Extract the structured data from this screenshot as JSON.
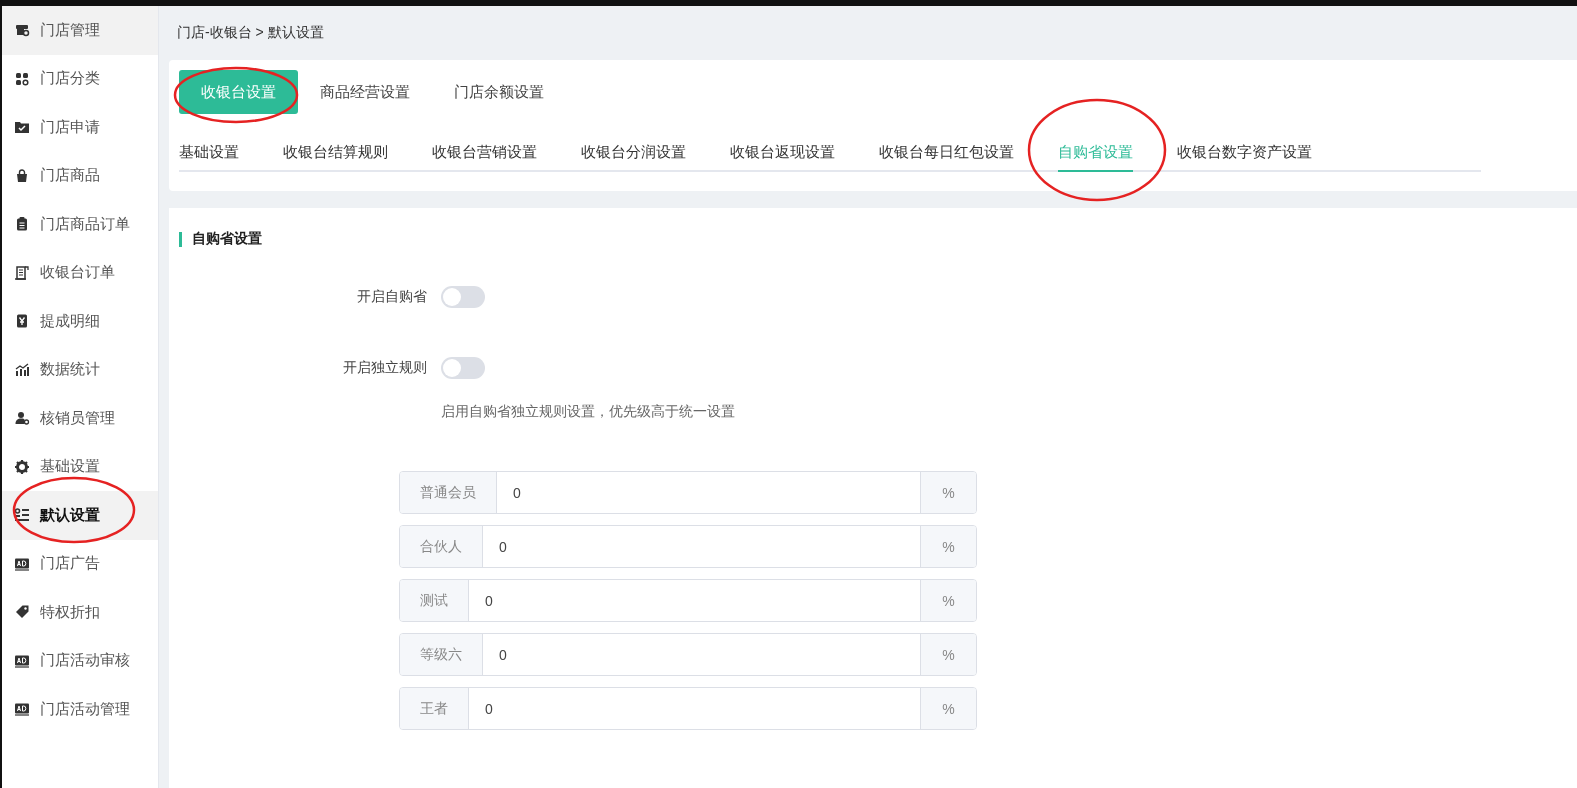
{
  "sidebar": {
    "items": [
      {
        "label": "门店管理",
        "selected": false,
        "hover": true
      },
      {
        "label": "门店分类",
        "selected": false,
        "hover": false
      },
      {
        "label": "门店申请",
        "selected": false,
        "hover": false
      },
      {
        "label": "门店商品",
        "selected": false,
        "hover": false
      },
      {
        "label": "门店商品订单",
        "selected": false,
        "hover": false
      },
      {
        "label": "收银台订单",
        "selected": false,
        "hover": false
      },
      {
        "label": "提成明细",
        "selected": false,
        "hover": false
      },
      {
        "label": "数据统计",
        "selected": false,
        "hover": false
      },
      {
        "label": "核销员管理",
        "selected": false,
        "hover": false
      },
      {
        "label": "基础设置",
        "selected": false,
        "hover": false
      },
      {
        "label": "默认设置",
        "selected": true,
        "hover": false
      },
      {
        "label": "门店广告",
        "selected": false,
        "hover": false
      },
      {
        "label": "特权折扣",
        "selected": false,
        "hover": false
      },
      {
        "label": "门店活动审核",
        "selected": false,
        "hover": false
      },
      {
        "label": "门店活动管理",
        "selected": false,
        "hover": false
      }
    ]
  },
  "breadcrumb": "门店-收银台 > 默认设置",
  "top_tabs": [
    {
      "label": "收银台设置",
      "selected": true
    },
    {
      "label": "商品经营设置",
      "selected": false
    },
    {
      "label": "门店余额设置",
      "selected": false
    }
  ],
  "sub_tabs": [
    {
      "label": "基础设置",
      "selected": false
    },
    {
      "label": "收银台结算规则",
      "selected": false
    },
    {
      "label": "收银台营销设置",
      "selected": false
    },
    {
      "label": "收银台分润设置",
      "selected": false
    },
    {
      "label": "收银台返现设置",
      "selected": false
    },
    {
      "label": "收银台每日红包设置",
      "selected": false
    },
    {
      "label": "自购省设置",
      "selected": true
    },
    {
      "label": "收银台数字资产设置",
      "selected": false
    }
  ],
  "section_title": "自购省设置",
  "switches": [
    {
      "label": "开启自购省",
      "on": false
    },
    {
      "label": "开启独立规则",
      "on": false
    }
  ],
  "hint": "启用自购省独立规则设置，优先级高于统一设置",
  "rates": [
    {
      "label": "普通会员",
      "value": "0",
      "unit": "%"
    },
    {
      "label": "合伙人",
      "value": "0",
      "unit": "%"
    },
    {
      "label": "测试",
      "value": "0",
      "unit": "%"
    },
    {
      "label": "等级六",
      "value": "0",
      "unit": "%"
    },
    {
      "label": "王者",
      "value": "0",
      "unit": "%"
    }
  ]
}
